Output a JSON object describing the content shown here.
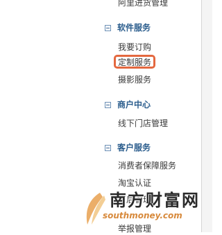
{
  "menu": {
    "top_item": "阿里进货管理",
    "sections": [
      {
        "title": "软件服务",
        "items": [
          "我要订购",
          "定制服务",
          "摄影服务"
        ]
      },
      {
        "title": "商户中心",
        "items": [
          "线下门店管理"
        ]
      },
      {
        "title": "客户服务",
        "items": [
          "消费者保障服务",
          "淘宝认证",
          "售后管理",
          "举报管理"
        ]
      }
    ]
  },
  "highlight": {
    "target": "定制服务",
    "color": "#e4683f"
  },
  "watermark": {
    "main": "南方财富网",
    "url": "southmoney.com",
    "color": "#d7893b"
  },
  "colors": {
    "section_title": "#2b5d8d",
    "text": "#3a3a3a"
  }
}
